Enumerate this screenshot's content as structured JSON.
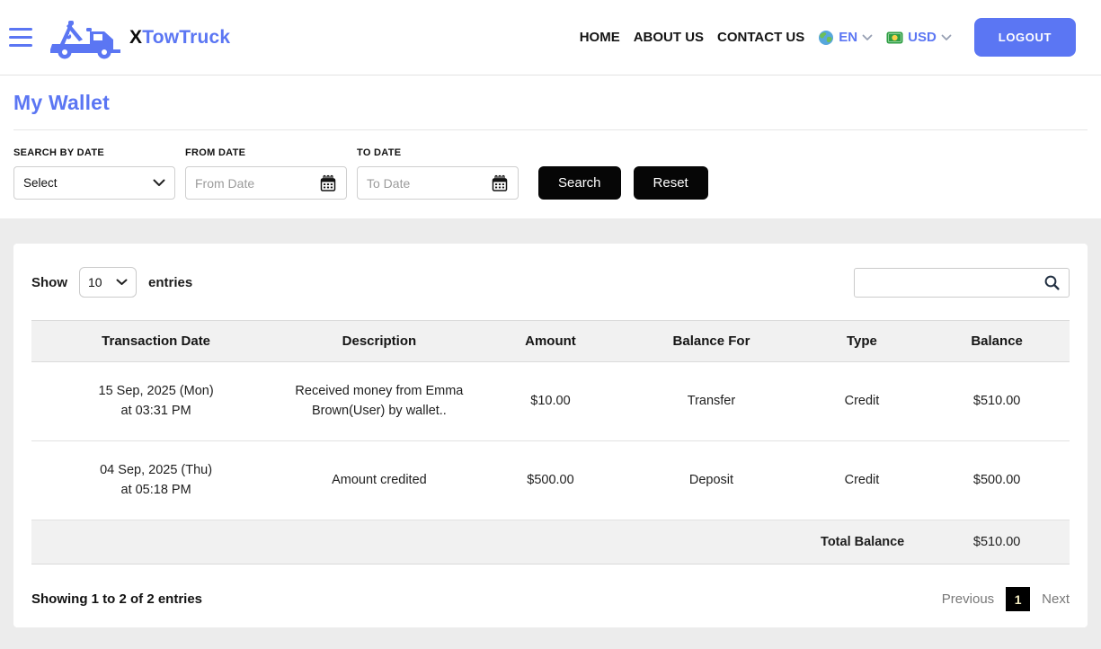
{
  "colors": {
    "accent_blue": "#5b76f3",
    "dark_button": "#060606",
    "section_background": "#ececec",
    "table_header_background": "#f1f1f1",
    "pagination_active_background": "#000000",
    "pagination_active_text": "#f3ecc2"
  },
  "header": {
    "brand_prefix": "X",
    "brand_suffix": "TowTruck",
    "nav": [
      {
        "label": "HOME"
      },
      {
        "label": "ABOUT US"
      },
      {
        "label": "CONTACT US"
      }
    ],
    "language": {
      "selected": "EN"
    },
    "currency": {
      "selected": "USD"
    },
    "logout_label": "LOGOUT"
  },
  "page": {
    "title": "My Wallet"
  },
  "filters": {
    "search_by_date": {
      "label": "SEARCH BY DATE",
      "selected": "Select"
    },
    "from_date": {
      "label": "FROM DATE",
      "placeholder": "From Date"
    },
    "to_date": {
      "label": "TO DATE",
      "placeholder": "To Date"
    },
    "search_button": "Search",
    "reset_button": "Reset"
  },
  "wallet_table": {
    "show_label": "Show",
    "page_size": "10",
    "entries_label": "entries",
    "search_value": "",
    "columns": [
      "Transaction Date",
      "Description",
      "Amount",
      "Balance For",
      "Type",
      "Balance"
    ],
    "rows": [
      {
        "date_line1": "15 Sep, 2025 (Mon)",
        "date_line2": "at 03:31 PM",
        "description": "Received money from Emma Brown(User) by wallet..",
        "amount": "$10.00",
        "balance_for": "Transfer",
        "type": "Credit",
        "balance": "$510.00"
      },
      {
        "date_line1": "04 Sep, 2025 (Thu)",
        "date_line2": "at 05:18 PM",
        "description": "Amount credited",
        "amount": "$500.00",
        "balance_for": "Deposit",
        "type": "Credit",
        "balance": "$500.00"
      }
    ],
    "total_label": "Total Balance",
    "total_value": "$510.00",
    "summary": "Showing 1 to 2 of 2 entries",
    "pagination": {
      "previous": "Previous",
      "current_page": "1",
      "next": "Next"
    }
  }
}
